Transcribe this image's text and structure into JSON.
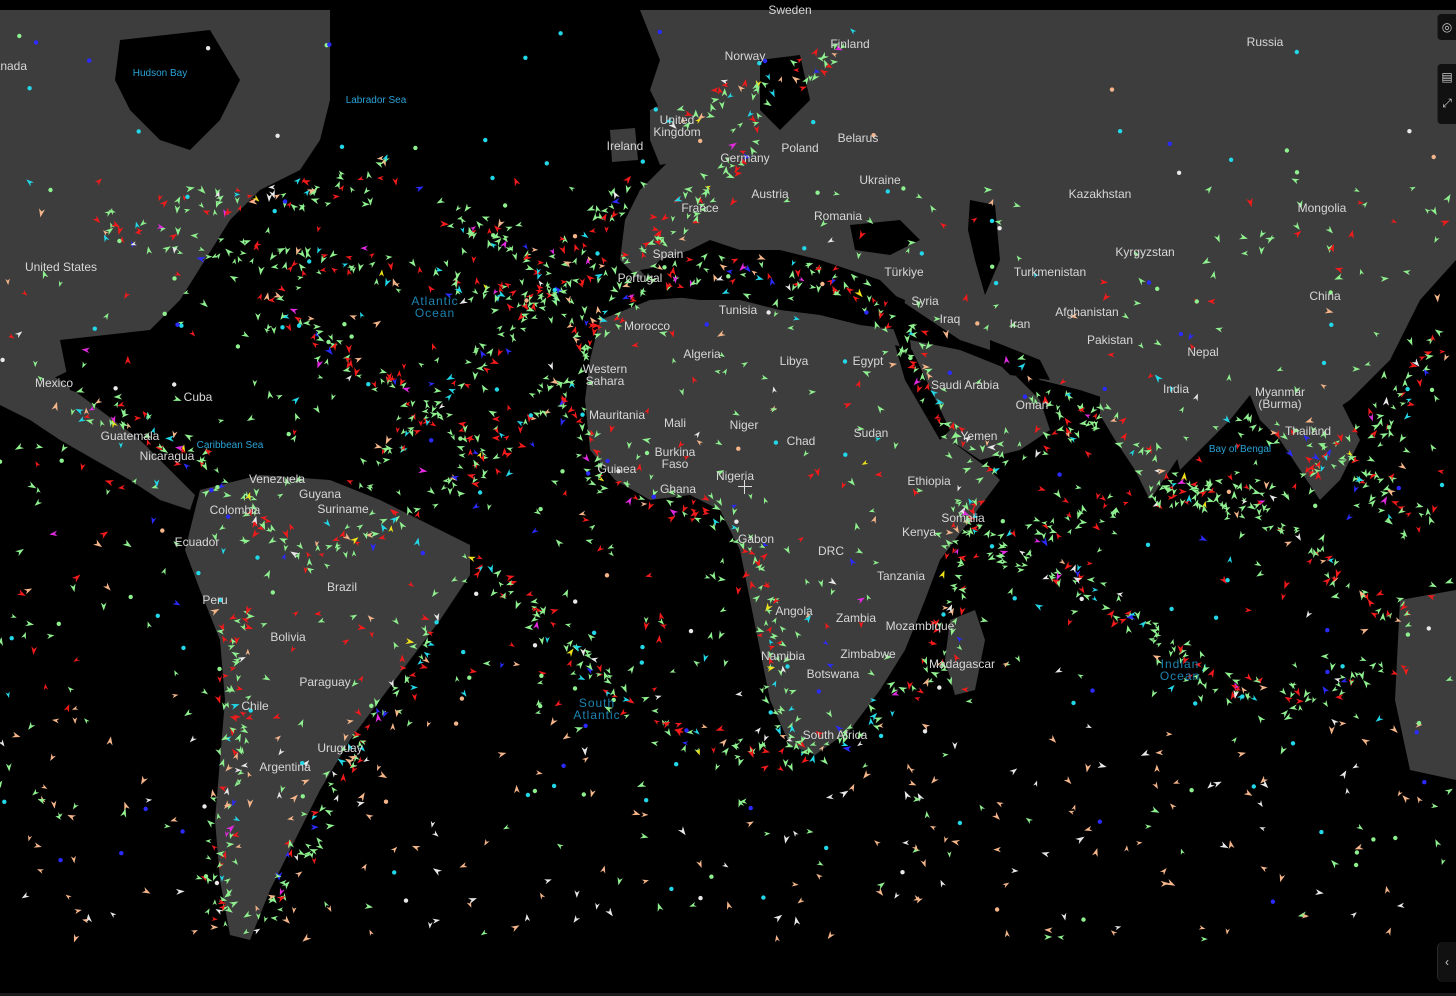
{
  "map": {
    "countries": [
      {
        "id": "sweden",
        "label": "Sweden"
      },
      {
        "id": "finland",
        "label": "Finland"
      },
      {
        "id": "russia",
        "label": "Russia"
      },
      {
        "id": "norway",
        "label": "Norway"
      },
      {
        "id": "belarus",
        "label": "Belarus"
      },
      {
        "id": "poland",
        "label": "Poland"
      },
      {
        "id": "ukraine",
        "label": "Ukraine"
      },
      {
        "id": "kazakhstan",
        "label": "Kazakhstan"
      },
      {
        "id": "mongolia",
        "label": "Mongolia"
      },
      {
        "id": "ireland",
        "label": "Ireland"
      },
      {
        "id": "united-kingdom",
        "label": "United\nKingdom"
      },
      {
        "id": "germany",
        "label": "Germany"
      },
      {
        "id": "france",
        "label": "France"
      },
      {
        "id": "austria",
        "label": "Austria"
      },
      {
        "id": "romania",
        "label": "Romania"
      },
      {
        "id": "spain",
        "label": "Spain"
      },
      {
        "id": "portugal",
        "label": "Portugal"
      },
      {
        "id": "turkiye",
        "label": "Türkiye"
      },
      {
        "id": "kyrgyzstan",
        "label": "Kyrgyzstan"
      },
      {
        "id": "turkmenistan",
        "label": "Turkmenistan"
      },
      {
        "id": "china",
        "label": "China"
      },
      {
        "id": "syria",
        "label": "Syria"
      },
      {
        "id": "iraq",
        "label": "Iraq"
      },
      {
        "id": "iran",
        "label": "Iran"
      },
      {
        "id": "afghanistan",
        "label": "Afghanistan"
      },
      {
        "id": "pakistan",
        "label": "Pakistan"
      },
      {
        "id": "nepal",
        "label": "Nepal"
      },
      {
        "id": "tunisia",
        "label": "Tunisia"
      },
      {
        "id": "morocco",
        "label": "Morocco"
      },
      {
        "id": "algeria",
        "label": "Algeria"
      },
      {
        "id": "libya",
        "label": "Libya"
      },
      {
        "id": "egypt",
        "label": "Egypt"
      },
      {
        "id": "saudi-arabia",
        "label": "Saudi Arabia"
      },
      {
        "id": "india",
        "label": "India"
      },
      {
        "id": "myanmar",
        "label": "Myanmar\n(Burma)"
      },
      {
        "id": "oman",
        "label": "Oman"
      },
      {
        "id": "western-sahara",
        "label": "Western\nSahara"
      },
      {
        "id": "mauritania",
        "label": "Mauritania"
      },
      {
        "id": "mali",
        "label": "Mali"
      },
      {
        "id": "niger",
        "label": "Niger"
      },
      {
        "id": "chad",
        "label": "Chad"
      },
      {
        "id": "sudan",
        "label": "Sudan"
      },
      {
        "id": "yemen",
        "label": "Yemen"
      },
      {
        "id": "thailand",
        "label": "Thailand"
      },
      {
        "id": "burkina-faso",
        "label": "Burkina\nFaso"
      },
      {
        "id": "guinea",
        "label": "Guinea"
      },
      {
        "id": "nigeria",
        "label": "Nigeria"
      },
      {
        "id": "ghana",
        "label": "Ghana"
      },
      {
        "id": "ethiopia",
        "label": "Ethiopia"
      },
      {
        "id": "somalia",
        "label": "Somalia"
      },
      {
        "id": "kenya",
        "label": "Kenya"
      },
      {
        "id": "gabon",
        "label": "Gabon"
      },
      {
        "id": "drc",
        "label": "DRC"
      },
      {
        "id": "tanzania",
        "label": "Tanzania"
      },
      {
        "id": "angola",
        "label": "Angola"
      },
      {
        "id": "zambia",
        "label": "Zambia"
      },
      {
        "id": "mozambique",
        "label": "Mozambique"
      },
      {
        "id": "namibia",
        "label": "Namibia"
      },
      {
        "id": "zimbabwe",
        "label": "Zimbabwe"
      },
      {
        "id": "botswana",
        "label": "Botswana"
      },
      {
        "id": "madagascar",
        "label": "Madagascar"
      },
      {
        "id": "south-africa",
        "label": "South Africa"
      },
      {
        "id": "canada",
        "label": "Canada"
      },
      {
        "id": "united-states",
        "label": "United States"
      },
      {
        "id": "mexico",
        "label": "Mexico"
      },
      {
        "id": "cuba",
        "label": "Cuba"
      },
      {
        "id": "guatemala",
        "label": "Guatemala"
      },
      {
        "id": "nicaragua",
        "label": "Nicaragua"
      },
      {
        "id": "venezuela",
        "label": "Venezuela"
      },
      {
        "id": "guyana",
        "label": "Guyana"
      },
      {
        "id": "suriname",
        "label": "Suriname"
      },
      {
        "id": "colombia",
        "label": "Colombia"
      },
      {
        "id": "ecuador",
        "label": "Ecuador"
      },
      {
        "id": "peru",
        "label": "Peru"
      },
      {
        "id": "brazil",
        "label": "Brazil"
      },
      {
        "id": "bolivia",
        "label": "Bolivia"
      },
      {
        "id": "paraguay",
        "label": "Paraguay"
      },
      {
        "id": "chile",
        "label": "Chile"
      },
      {
        "id": "uruguay",
        "label": "Uruguay"
      },
      {
        "id": "argentina",
        "label": "Argentina"
      }
    ],
    "water": [
      {
        "id": "hudson-bay",
        "label": "Hudson Bay"
      },
      {
        "id": "labrador-sea",
        "label": "Labrador Sea"
      },
      {
        "id": "caribbean-sea",
        "label": "Caribbean Sea"
      },
      {
        "id": "bay-of-bengal",
        "label": "Bay of Bengal"
      }
    ],
    "oceans": [
      {
        "id": "atlantic-ocean",
        "label": "Atlantic\nOcean"
      },
      {
        "id": "south-atlantic",
        "label": "South\nAtlantic"
      },
      {
        "id": "indian-ocean",
        "label": "Indian\nOcean"
      }
    ],
    "vessel_colors": {
      "cargo": "#8ef08e",
      "tanker": "#f21a1a",
      "passenger": "#2b2bff",
      "fishing": "#f5b58a",
      "tug_special": "#22d8e8",
      "pleasure": "#e22be0",
      "other": "#e8e8e8",
      "highspeed": "#f0e21a"
    },
    "land_color": "#3d3d3d",
    "sea_color": "#000000"
  },
  "controls": {
    "top_icon": "compass-icon",
    "layers_icon": "layers-icon",
    "bottom_icon": "chevron-icon"
  }
}
